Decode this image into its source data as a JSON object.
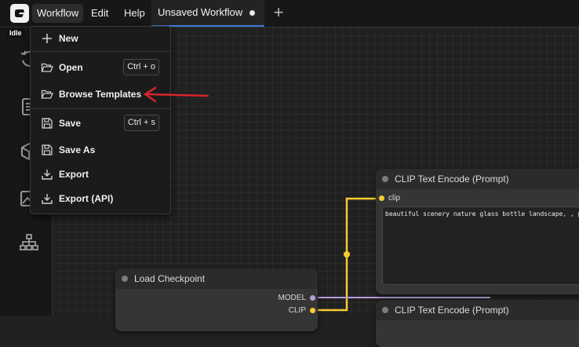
{
  "menubar": {
    "items": [
      {
        "label": "Workflow"
      },
      {
        "label": "Edit"
      },
      {
        "label": "Help"
      }
    ]
  },
  "tab": {
    "label": "Unsaved Workflow"
  },
  "status": {
    "label": "Idle"
  },
  "workflow_menu": {
    "items": [
      {
        "label": "New",
        "icon": "plus-icon"
      },
      {
        "label": "Open",
        "icon": "folder-open-icon",
        "shortcut": "Ctrl + o"
      },
      {
        "label": "Browse Templates",
        "icon": "folder-open-icon"
      },
      {
        "label": "Save",
        "icon": "save-icon",
        "shortcut": "Ctrl + s"
      },
      {
        "label": "Save As",
        "icon": "save-icon"
      },
      {
        "label": "Export",
        "icon": "download-icon"
      },
      {
        "label": "Export (API)",
        "icon": "download-icon"
      }
    ]
  },
  "nodes": {
    "clip_top": {
      "title": "CLIP Text Encode (Prompt)",
      "input": "clip",
      "text": "beautiful scenery nature glass bottle landscape, , purp"
    },
    "checkpoint": {
      "title": "Load Checkpoint",
      "outputs": [
        "MODEL",
        "CLIP"
      ]
    },
    "clip_bottom": {
      "title": "CLIP Text Encode (Prompt)"
    }
  },
  "colors": {
    "clip_wire": "#f5cd32",
    "model_wire": "#b39ddb",
    "annotation_arrow": "#d6252c",
    "active_tab_border": "#3d7bd8"
  }
}
